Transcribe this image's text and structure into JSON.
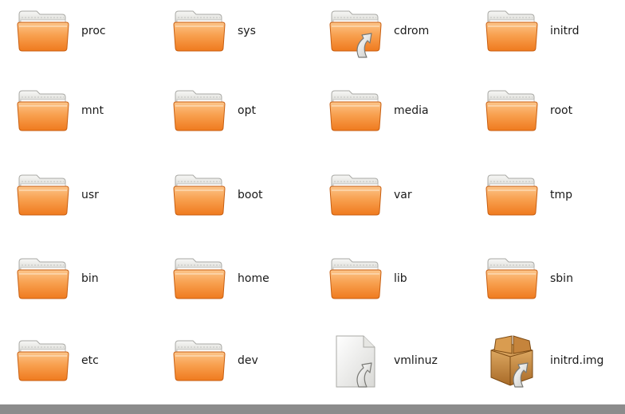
{
  "files": [
    {
      "name": "proc",
      "icon": "folder-icon",
      "link": false
    },
    {
      "name": "sys",
      "icon": "folder-icon",
      "link": false
    },
    {
      "name": "cdrom",
      "icon": "folder-symlink-icon",
      "link": true
    },
    {
      "name": "initrd",
      "icon": "folder-icon",
      "link": false
    },
    {
      "name": "mnt",
      "icon": "folder-icon",
      "link": false
    },
    {
      "name": "opt",
      "icon": "folder-icon",
      "link": false
    },
    {
      "name": "media",
      "icon": "folder-icon",
      "link": false
    },
    {
      "name": "root",
      "icon": "folder-icon",
      "link": false
    },
    {
      "name": "usr",
      "icon": "folder-icon",
      "link": false
    },
    {
      "name": "boot",
      "icon": "folder-icon",
      "link": false
    },
    {
      "name": "var",
      "icon": "folder-icon",
      "link": false
    },
    {
      "name": "tmp",
      "icon": "folder-icon",
      "link": false
    },
    {
      "name": "bin",
      "icon": "folder-icon",
      "link": false
    },
    {
      "name": "home",
      "icon": "folder-icon",
      "link": false
    },
    {
      "name": "lib",
      "icon": "folder-icon",
      "link": false
    },
    {
      "name": "sbin",
      "icon": "folder-icon",
      "link": false
    },
    {
      "name": "etc",
      "icon": "folder-icon",
      "link": false
    },
    {
      "name": "dev",
      "icon": "folder-icon",
      "link": false
    },
    {
      "name": "vmlinuz",
      "icon": "file-symlink-icon",
      "link": true
    },
    {
      "name": "initrd.img",
      "icon": "package-symlink-icon",
      "link": true
    }
  ],
  "colors": {
    "folder_light": "#fbb873",
    "folder_dark": "#f07a1f",
    "folder_tab": "#eeeeec",
    "background": "#ffffff",
    "statusbar": "#8c8c8c"
  }
}
